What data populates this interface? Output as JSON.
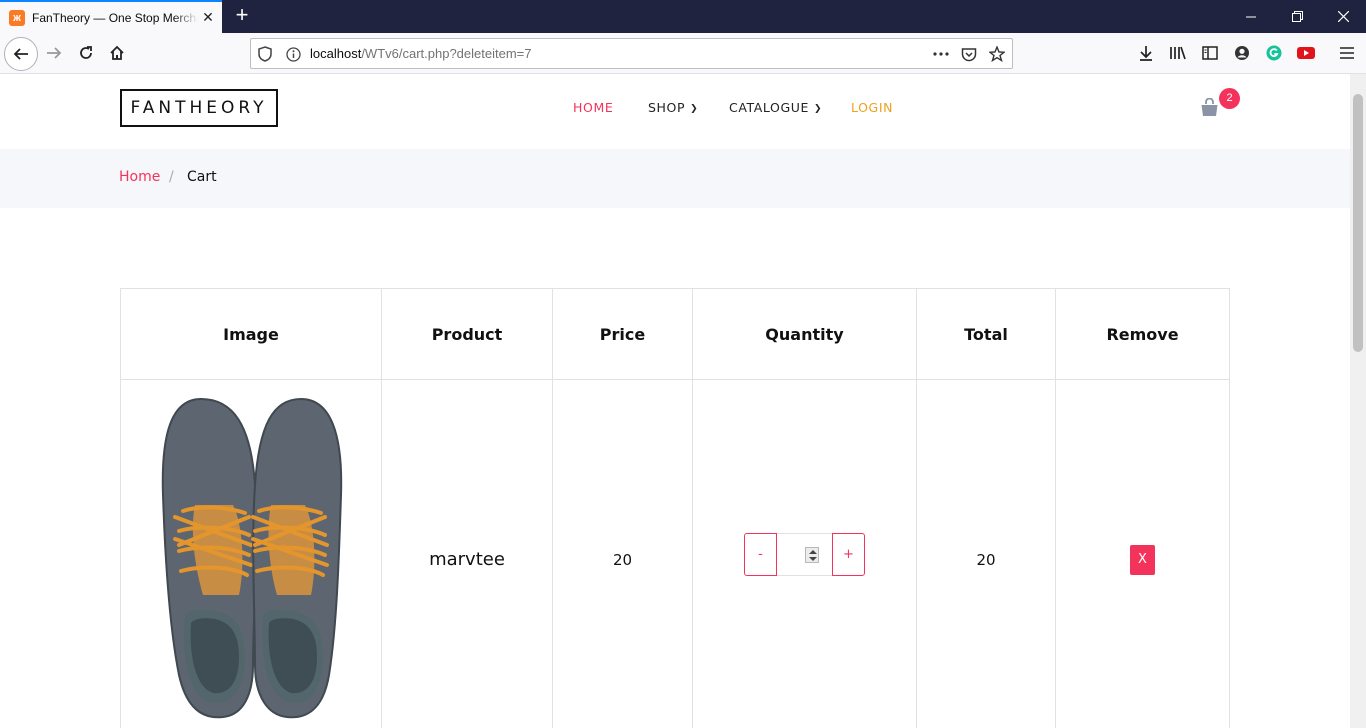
{
  "browser": {
    "tab_title": "FanTheory — One Stop Merchandise",
    "url_host": "localhost",
    "url_path": "/WTv6/cart.php?deleteitem=7"
  },
  "header": {
    "logo": "FANTHEORY",
    "menu": {
      "home": "HOME",
      "shop": "SHOP",
      "catalogue": "CATALOGUE",
      "login": "LOGIN"
    },
    "cart_count": "2"
  },
  "breadcrumb": {
    "home": "Home",
    "separator": "/",
    "current": "Cart"
  },
  "cart": {
    "headers": [
      "Image",
      "Product",
      "Price",
      "Quantity",
      "Total",
      "Remove"
    ],
    "rows": [
      {
        "product": "marvtee",
        "price": "20",
        "quantity_minus": "-",
        "quantity_plus": "+",
        "total": "20",
        "remove": "X"
      }
    ]
  },
  "colors": {
    "accent": "#f3335c",
    "login": "#f0a01e",
    "breadcrumb_bg": "#f6f7fa"
  }
}
